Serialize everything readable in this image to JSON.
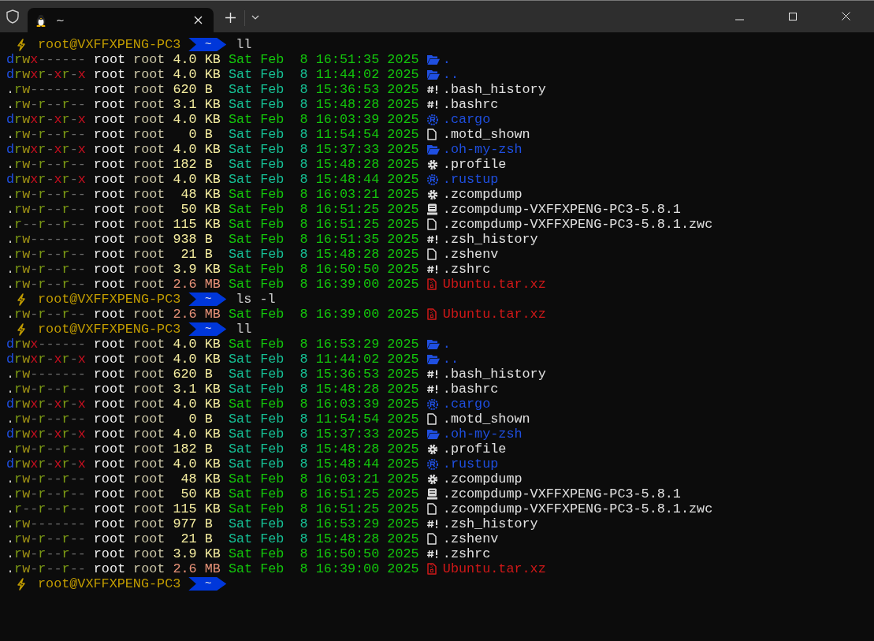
{
  "tab": {
    "title": "~",
    "selected": true
  },
  "lines": [
    {
      "kind": "prompt",
      "host": "root@VXFFXPENG-PC3",
      "path": "~",
      "command": "ll"
    },
    {
      "kind": "dir",
      "perms": "drwx------",
      "user": "root",
      "group": "root",
      "size": "4.0",
      "unit": "KB",
      "large": false,
      "date": "Sat Feb  8",
      "recent": true,
      "time": "16:51:35",
      "year": "2025",
      "name": "."
    },
    {
      "kind": "dir",
      "perms": "drwxr-xr-x",
      "user": "root",
      "group": "root",
      "size": "4.0",
      "unit": "KB",
      "large": false,
      "date": "Sat Feb  8",
      "recent": false,
      "time": "11:44:02",
      "year": "2025",
      "name": ".."
    },
    {
      "kind": "script",
      "perms": ".rw-------",
      "user": "root",
      "group": "root",
      "size": "620",
      "unit": "B",
      "large": false,
      "date": "Sat Feb  8",
      "recent": false,
      "time": "15:36:53",
      "year": "2025",
      "name": ".bash_history"
    },
    {
      "kind": "script",
      "perms": ".rw-r--r--",
      "user": "root",
      "group": "root",
      "size": "3.1",
      "unit": "KB",
      "large": false,
      "date": "Sat Feb  8",
      "recent": false,
      "time": "15:48:28",
      "year": "2025",
      "name": ".bashrc"
    },
    {
      "kind": "cogdir",
      "perms": "drwxr-xr-x",
      "user": "root",
      "group": "root",
      "size": "4.0",
      "unit": "KB",
      "large": false,
      "date": "Sat Feb  8",
      "recent": true,
      "time": "16:03:39",
      "year": "2025",
      "name": ".cargo"
    },
    {
      "kind": "file",
      "perms": ".rw-r--r--",
      "user": "root",
      "group": "root",
      "size": "0",
      "unit": "B",
      "large": false,
      "date": "Sat Feb  8",
      "recent": false,
      "time": "11:54:54",
      "year": "2025",
      "name": ".motd_shown"
    },
    {
      "kind": "dir",
      "perms": "drwxr-xr-x",
      "user": "root",
      "group": "root",
      "size": "4.0",
      "unit": "KB",
      "large": false,
      "date": "Sat Feb  8",
      "recent": false,
      "time": "15:37:33",
      "year": "2025",
      "name": ".oh-my-zsh"
    },
    {
      "kind": "config",
      "perms": ".rw-r--r--",
      "user": "root",
      "group": "root",
      "size": "182",
      "unit": "B",
      "large": false,
      "date": "Sat Feb  8",
      "recent": false,
      "time": "15:48:28",
      "year": "2025",
      "name": ".profile"
    },
    {
      "kind": "cogdir",
      "perms": "drwxr-xr-x",
      "user": "root",
      "group": "root",
      "size": "4.0",
      "unit": "KB",
      "large": false,
      "date": "Sat Feb  8",
      "recent": false,
      "time": "15:48:44",
      "year": "2025",
      "name": ".rustup"
    },
    {
      "kind": "config",
      "perms": ".rw-r--r--",
      "user": "root",
      "group": "root",
      "size": "48",
      "unit": "KB",
      "large": false,
      "date": "Sat Feb  8",
      "recent": true,
      "time": "16:03:21",
      "year": "2025",
      "name": ".zcompdump"
    },
    {
      "kind": "binary",
      "perms": ".rw-r--r--",
      "user": "root",
      "group": "root",
      "size": "50",
      "unit": "KB",
      "large": false,
      "date": "Sat Feb  8",
      "recent": true,
      "time": "16:51:25",
      "year": "2025",
      "name": ".zcompdump-VXFFXPENG-PC3-5.8.1"
    },
    {
      "kind": "file",
      "perms": ".r--r--r--",
      "user": "root",
      "group": "root",
      "size": "115",
      "unit": "KB",
      "large": false,
      "date": "Sat Feb  8",
      "recent": true,
      "time": "16:51:25",
      "year": "2025",
      "name": ".zcompdump-VXFFXPENG-PC3-5.8.1.zwc"
    },
    {
      "kind": "script",
      "perms": ".rw-------",
      "user": "root",
      "group": "root",
      "size": "938",
      "unit": "B",
      "large": false,
      "date": "Sat Feb  8",
      "recent": true,
      "time": "16:51:35",
      "year": "2025",
      "name": ".zsh_history"
    },
    {
      "kind": "file",
      "perms": ".rw-r--r--",
      "user": "root",
      "group": "root",
      "size": "21",
      "unit": "B",
      "large": false,
      "date": "Sat Feb  8",
      "recent": false,
      "time": "15:48:28",
      "year": "2025",
      "name": ".zshenv"
    },
    {
      "kind": "script",
      "perms": ".rw-r--r--",
      "user": "root",
      "group": "root",
      "size": "3.9",
      "unit": "KB",
      "large": false,
      "date": "Sat Feb  8",
      "recent": true,
      "time": "16:50:50",
      "year": "2025",
      "name": ".zshrc"
    },
    {
      "kind": "archive",
      "perms": ".rw-r--r--",
      "user": "root",
      "group": "root",
      "size": "2.6",
      "unit": "MB",
      "large": true,
      "date": "Sat Feb  8",
      "recent": true,
      "time": "16:39:00",
      "year": "2025",
      "name": "Ubuntu.tar.xz"
    },
    {
      "kind": "prompt",
      "host": "root@VXFFXPENG-PC3",
      "path": "~",
      "command": "ls -l"
    },
    {
      "kind": "archive",
      "perms": ".rw-r--r--",
      "user": "root",
      "group": "root",
      "size": "2.6",
      "unit": "MB",
      "large": true,
      "date": "Sat Feb  8",
      "recent": true,
      "time": "16:39:00",
      "year": "2025",
      "name": "Ubuntu.tar.xz"
    },
    {
      "kind": "prompt",
      "host": "root@VXFFXPENG-PC3",
      "path": "~",
      "command": "ll"
    },
    {
      "kind": "dir",
      "perms": "drwx------",
      "user": "root",
      "group": "root",
      "size": "4.0",
      "unit": "KB",
      "large": false,
      "date": "Sat Feb  8",
      "recent": true,
      "time": "16:53:29",
      "year": "2025",
      "name": "."
    },
    {
      "kind": "dir",
      "perms": "drwxr-xr-x",
      "user": "root",
      "group": "root",
      "size": "4.0",
      "unit": "KB",
      "large": false,
      "date": "Sat Feb  8",
      "recent": false,
      "time": "11:44:02",
      "year": "2025",
      "name": ".."
    },
    {
      "kind": "script",
      "perms": ".rw-------",
      "user": "root",
      "group": "root",
      "size": "620",
      "unit": "B",
      "large": false,
      "date": "Sat Feb  8",
      "recent": false,
      "time": "15:36:53",
      "year": "2025",
      "name": ".bash_history"
    },
    {
      "kind": "script",
      "perms": ".rw-r--r--",
      "user": "root",
      "group": "root",
      "size": "3.1",
      "unit": "KB",
      "large": false,
      "date": "Sat Feb  8",
      "recent": false,
      "time": "15:48:28",
      "year": "2025",
      "name": ".bashrc"
    },
    {
      "kind": "cogdir",
      "perms": "drwxr-xr-x",
      "user": "root",
      "group": "root",
      "size": "4.0",
      "unit": "KB",
      "large": false,
      "date": "Sat Feb  8",
      "recent": true,
      "time": "16:03:39",
      "year": "2025",
      "name": ".cargo"
    },
    {
      "kind": "file",
      "perms": ".rw-r--r--",
      "user": "root",
      "group": "root",
      "size": "0",
      "unit": "B",
      "large": false,
      "date": "Sat Feb  8",
      "recent": false,
      "time": "11:54:54",
      "year": "2025",
      "name": ".motd_shown"
    },
    {
      "kind": "dir",
      "perms": "drwxr-xr-x",
      "user": "root",
      "group": "root",
      "size": "4.0",
      "unit": "KB",
      "large": false,
      "date": "Sat Feb  8",
      "recent": false,
      "time": "15:37:33",
      "year": "2025",
      "name": ".oh-my-zsh"
    },
    {
      "kind": "config",
      "perms": ".rw-r--r--",
      "user": "root",
      "group": "root",
      "size": "182",
      "unit": "B",
      "large": false,
      "date": "Sat Feb  8",
      "recent": false,
      "time": "15:48:28",
      "year": "2025",
      "name": ".profile"
    },
    {
      "kind": "cogdir",
      "perms": "drwxr-xr-x",
      "user": "root",
      "group": "root",
      "size": "4.0",
      "unit": "KB",
      "large": false,
      "date": "Sat Feb  8",
      "recent": false,
      "time": "15:48:44",
      "year": "2025",
      "name": ".rustup"
    },
    {
      "kind": "config",
      "perms": ".rw-r--r--",
      "user": "root",
      "group": "root",
      "size": "48",
      "unit": "KB",
      "large": false,
      "date": "Sat Feb  8",
      "recent": true,
      "time": "16:03:21",
      "year": "2025",
      "name": ".zcompdump"
    },
    {
      "kind": "binary",
      "perms": ".rw-r--r--",
      "user": "root",
      "group": "root",
      "size": "50",
      "unit": "KB",
      "large": false,
      "date": "Sat Feb  8",
      "recent": true,
      "time": "16:51:25",
      "year": "2025",
      "name": ".zcompdump-VXFFXPENG-PC3-5.8.1"
    },
    {
      "kind": "file",
      "perms": ".r--r--r--",
      "user": "root",
      "group": "root",
      "size": "115",
      "unit": "KB",
      "large": false,
      "date": "Sat Feb  8",
      "recent": true,
      "time": "16:51:25",
      "year": "2025",
      "name": ".zcompdump-VXFFXPENG-PC3-5.8.1.zwc"
    },
    {
      "kind": "script",
      "perms": ".rw-------",
      "user": "root",
      "group": "root",
      "size": "977",
      "unit": "B",
      "large": false,
      "date": "Sat Feb  8",
      "recent": false,
      "time": "16:53:29",
      "year": "2025",
      "name": ".zsh_history"
    },
    {
      "kind": "file",
      "perms": ".rw-r--r--",
      "user": "root",
      "group": "root",
      "size": "21",
      "unit": "B",
      "large": false,
      "date": "Sat Feb  8",
      "recent": false,
      "time": "15:48:28",
      "year": "2025",
      "name": ".zshenv"
    },
    {
      "kind": "script",
      "perms": ".rw-r--r--",
      "user": "root",
      "group": "root",
      "size": "3.9",
      "unit": "KB",
      "large": false,
      "date": "Sat Feb  8",
      "recent": true,
      "time": "16:50:50",
      "year": "2025",
      "name": ".zshrc"
    },
    {
      "kind": "archive",
      "perms": ".rw-r--r--",
      "user": "root",
      "group": "root",
      "size": "2.6",
      "unit": "MB",
      "large": true,
      "date": "Sat Feb  8",
      "recent": true,
      "time": "16:39:00",
      "year": "2025",
      "name": "Ubuntu.tar.xz"
    },
    {
      "kind": "prompt",
      "host": "root@VXFFXPENG-PC3",
      "path": "~"
    }
  ]
}
